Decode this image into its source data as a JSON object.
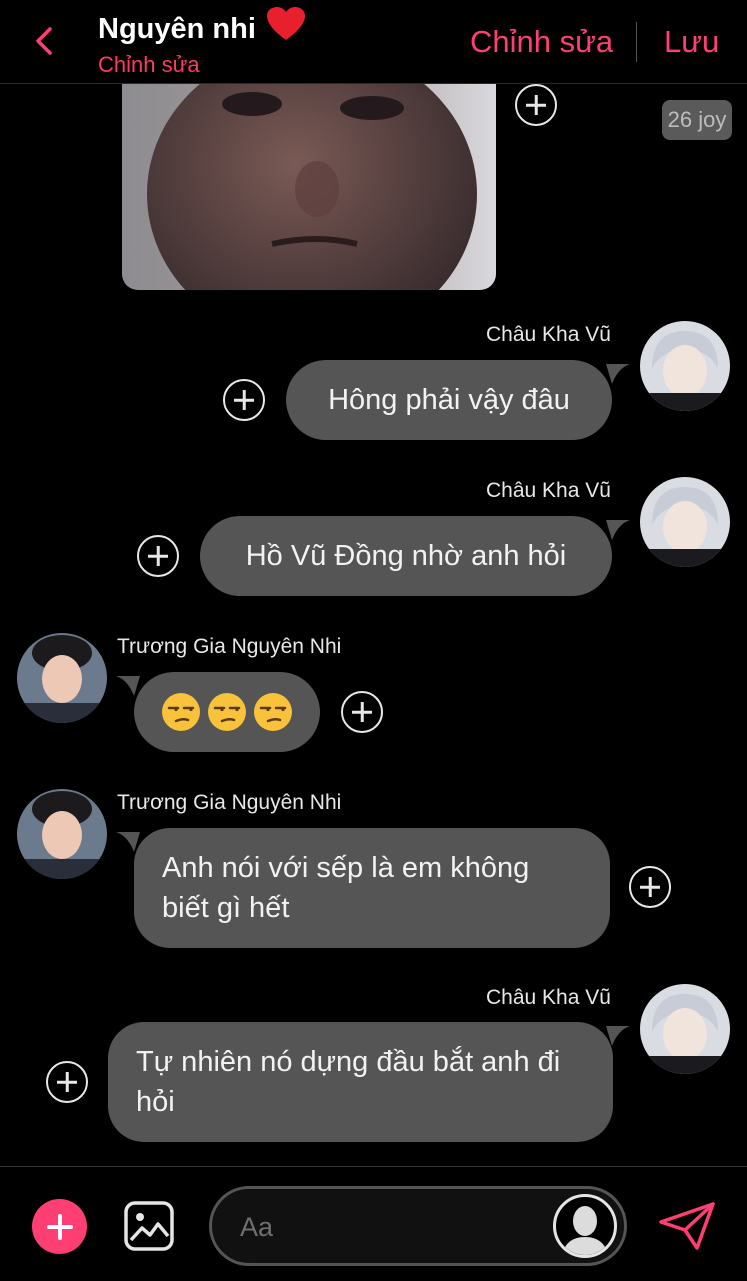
{
  "header": {
    "title": "Nguyên nhi",
    "subtitle": "Chỉnh sửa",
    "edit_label": "Chỉnh sửa",
    "save_label": "Lưu"
  },
  "photo_tag": "26 joy",
  "messages": [
    {
      "sender": "Châu Kha Vũ",
      "side": "right",
      "text": "Hông phải vậy đâu"
    },
    {
      "sender": "Châu Kha Vũ",
      "side": "right",
      "text": "Hồ Vũ Đồng nhờ anh hỏi"
    },
    {
      "sender": "Trương Gia Nguyên Nhi",
      "side": "left",
      "emoji_count": 3,
      "emoji": "unamused-face"
    },
    {
      "sender": "Trương Gia Nguyên Nhi",
      "side": "left",
      "text": "Anh nói với sếp là em không biết gì hết"
    },
    {
      "sender": "Châu Kha Vũ",
      "side": "right",
      "text": "Tự nhiên nó dựng đầu bắt anh đi hỏi"
    }
  ],
  "composer": {
    "placeholder": "Aa"
  },
  "colors": {
    "accent": "#ff3f73",
    "subtitle": "#ff3a5e",
    "bubble": "#555555",
    "background": "#000000"
  },
  "icons": [
    "back-chevron-icon",
    "heart-icon",
    "plus-circle-icon",
    "image-icon",
    "send-icon",
    "add-icon",
    "unamused-face-emoji"
  ]
}
